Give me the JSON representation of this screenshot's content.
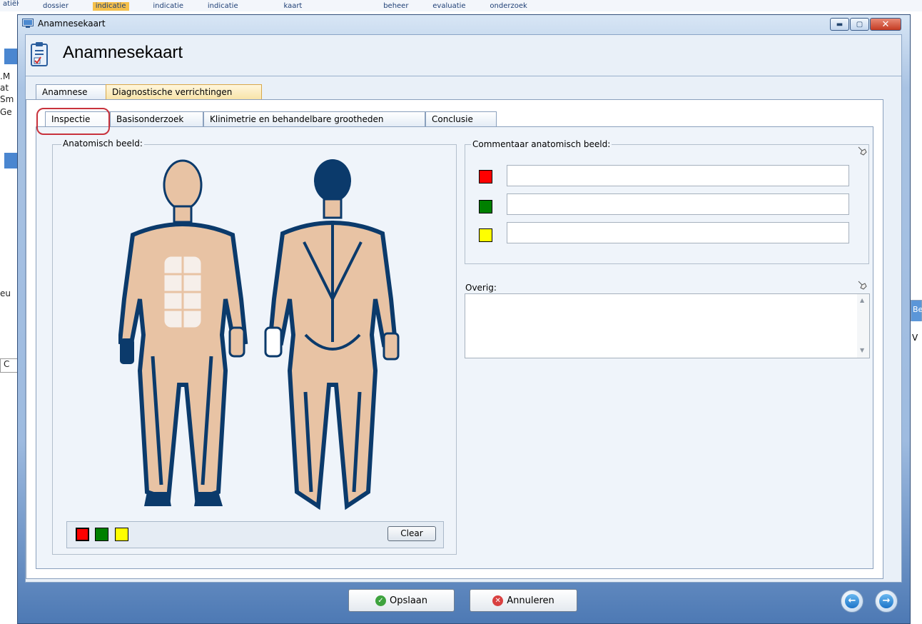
{
  "background_app": {
    "toolbar_items": [
      "atiëŀ",
      "dossier",
      "indicatie",
      "indicatie",
      "indicatie",
      "kaart",
      "▾",
      "beheer",
      "evaluatie",
      "onderzoek",
      "▾"
    ],
    "left_fragments": [
      ".M",
      "at",
      "Sm",
      "Ge",
      "eu",
      "C"
    ],
    "right_fragments": [
      "Be",
      "V"
    ]
  },
  "window": {
    "title": "Anamnesekaart",
    "header_title": "Anamnesekaart"
  },
  "tabs": {
    "primary": [
      "Anamnese",
      "Diagnostische verrichtingen"
    ],
    "primary_selected": "Diagnostische verrichtingen",
    "secondary": [
      "Inspectie",
      "Basisonderzoek",
      "Klinimetrie en behandelbare grootheden",
      "Conclusie"
    ],
    "secondary_selected": "Inspectie"
  },
  "anatomy": {
    "label": "Anatomisch beeld:",
    "palette": [
      "#ff0000",
      "#008000",
      "#ffff00"
    ],
    "selected_color": "#ff0000",
    "clear_label": "Clear"
  },
  "comments": {
    "label": "Commentaar anatomisch beeld:",
    "rows": [
      {
        "color": "#ff0000",
        "value": ""
      },
      {
        "color": "#008000",
        "value": ""
      },
      {
        "color": "#ffff00",
        "value": ""
      }
    ]
  },
  "overig": {
    "label": "Overig:",
    "value": ""
  },
  "buttons": {
    "save": "Opslaan",
    "cancel": "Annuleren"
  },
  "colors": {
    "body_outline": "#0b3a6b",
    "skin": "#e8c3a4",
    "highlight": "#c8323c"
  }
}
